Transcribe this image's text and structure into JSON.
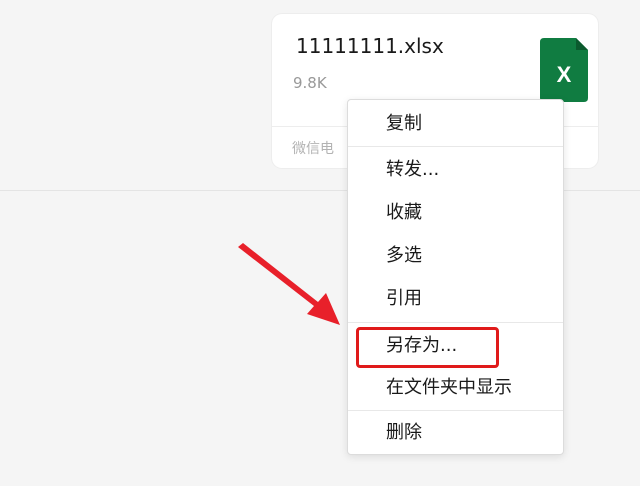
{
  "file_card": {
    "file_name": "11111111.xlsx",
    "file_size": "9.8K",
    "source": "微信电",
    "file_icon": "excel-icon",
    "file_icon_letter": "X",
    "icon_color": "#107c41"
  },
  "context_menu": {
    "items": [
      {
        "label": "复制"
      },
      {
        "label": "转发..."
      },
      {
        "label": "收藏"
      },
      {
        "label": "多选"
      },
      {
        "label": "引用"
      },
      {
        "label": "另存为..."
      },
      {
        "label": "在文件夹中显示"
      },
      {
        "label": "删除"
      }
    ]
  },
  "annotation": {
    "highlighted_item": "另存为...",
    "highlight_color": "#e01a1a",
    "arrow_color": "#e8202a"
  }
}
